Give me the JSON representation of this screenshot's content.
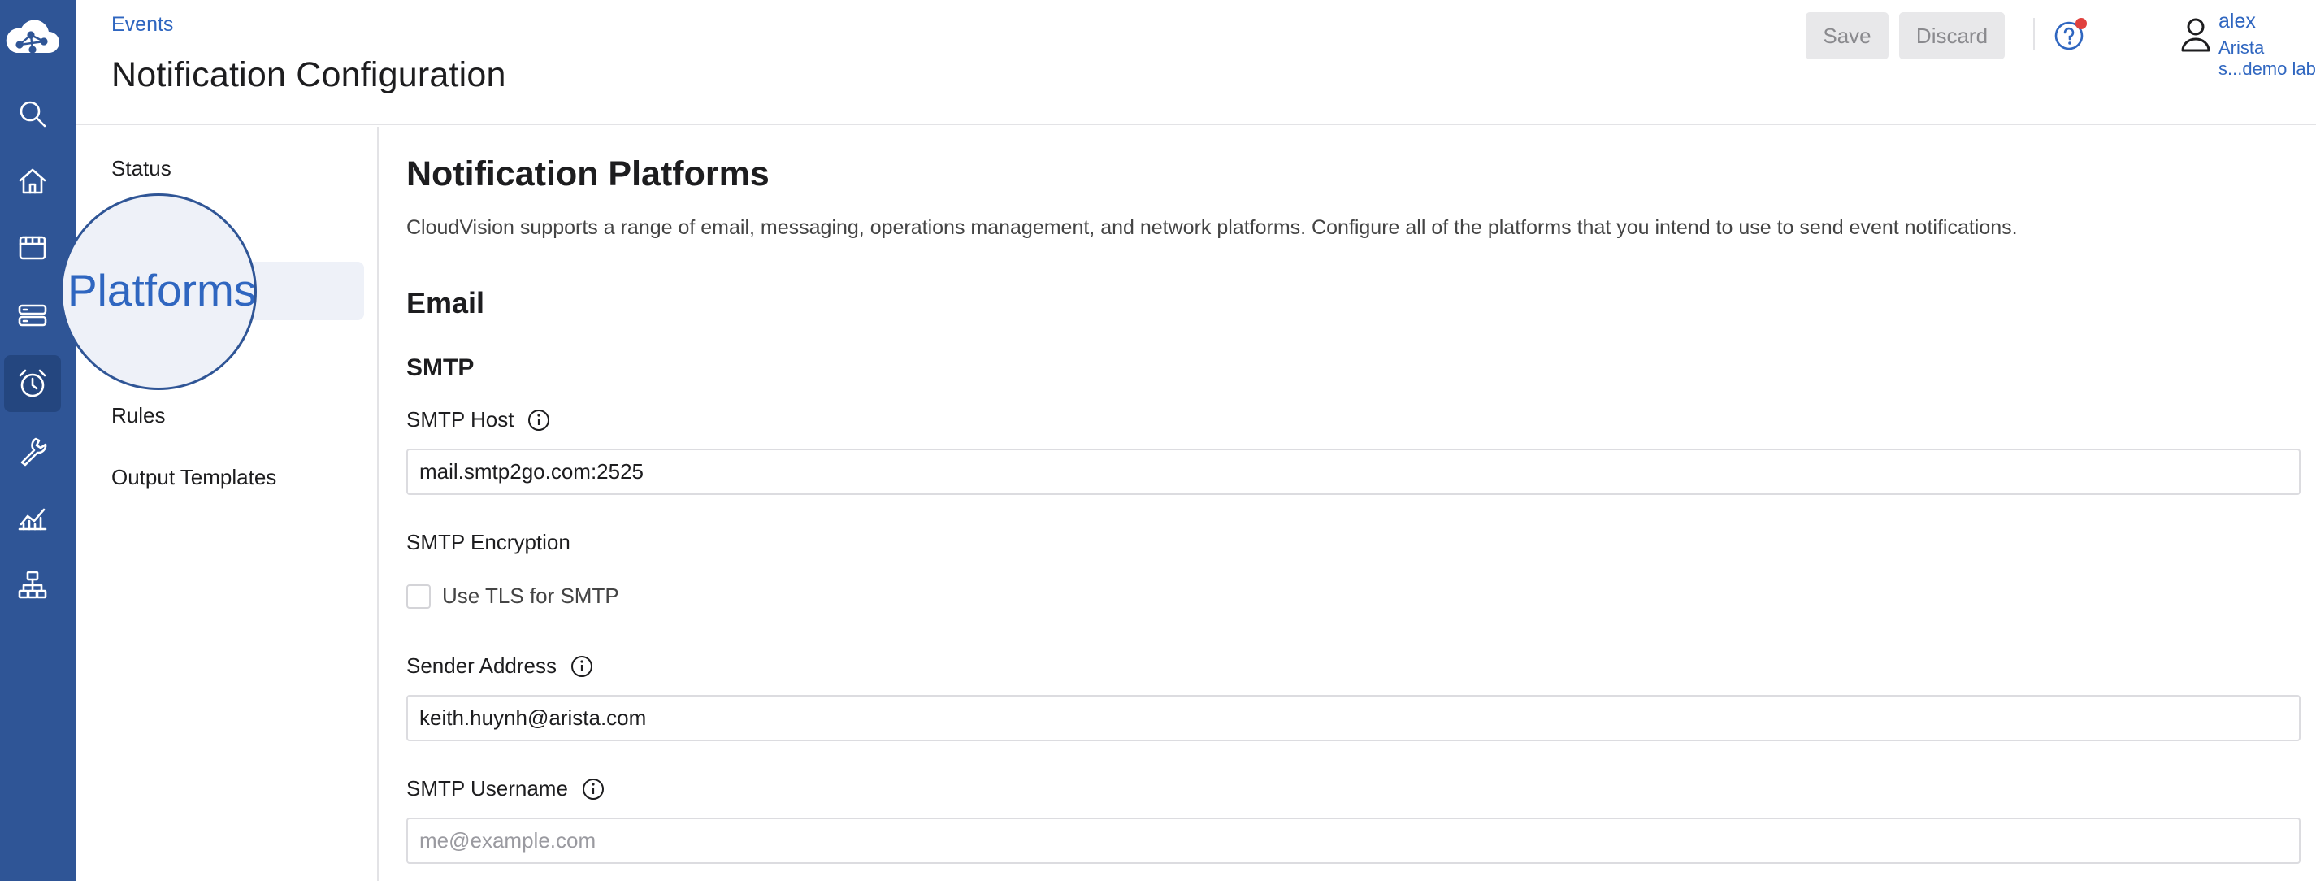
{
  "rail": {
    "items": [
      {
        "icon": "search-icon"
      },
      {
        "icon": "home-icon"
      },
      {
        "icon": "dashboard-icon"
      },
      {
        "icon": "devices-icon"
      },
      {
        "icon": "events-alarm-icon",
        "active": true
      },
      {
        "icon": "wrench-icon"
      },
      {
        "icon": "analytics-icon"
      },
      {
        "icon": "topology-icon"
      }
    ]
  },
  "header": {
    "breadcrumb": "Events",
    "title": "Notification Configuration",
    "save_label": "Save",
    "discard_label": "Discard",
    "user_name": "alex",
    "user_org": "Arista s...demo lab"
  },
  "subnav": {
    "items": [
      {
        "label": "Status"
      },
      {
        "label": "Platforms",
        "active": true
      },
      {
        "label": "Rules"
      },
      {
        "label": "Output Templates"
      }
    ]
  },
  "main": {
    "title": "Notification Platforms",
    "description": "CloudVision supports a range of email, messaging, operations management, and network platforms. Configure all of the platforms that you intend to use to send event notifications.",
    "section": "Email",
    "subsection": "SMTP",
    "smtp_host": {
      "label": "SMTP Host",
      "value": "mail.smtp2go.com:2525"
    },
    "smtp_encryption": {
      "label": "SMTP Encryption",
      "checkbox_label": "Use TLS for SMTP",
      "checked": false
    },
    "sender_address": {
      "label": "Sender Address",
      "value": "keith.huynh@arista.com"
    },
    "smtp_username": {
      "label": "SMTP Username",
      "value": "",
      "placeholder": "me@example.com"
    }
  },
  "colors": {
    "rail": "#2f5596",
    "accent": "#2f66c0",
    "notification_dot": "#e0413e"
  }
}
